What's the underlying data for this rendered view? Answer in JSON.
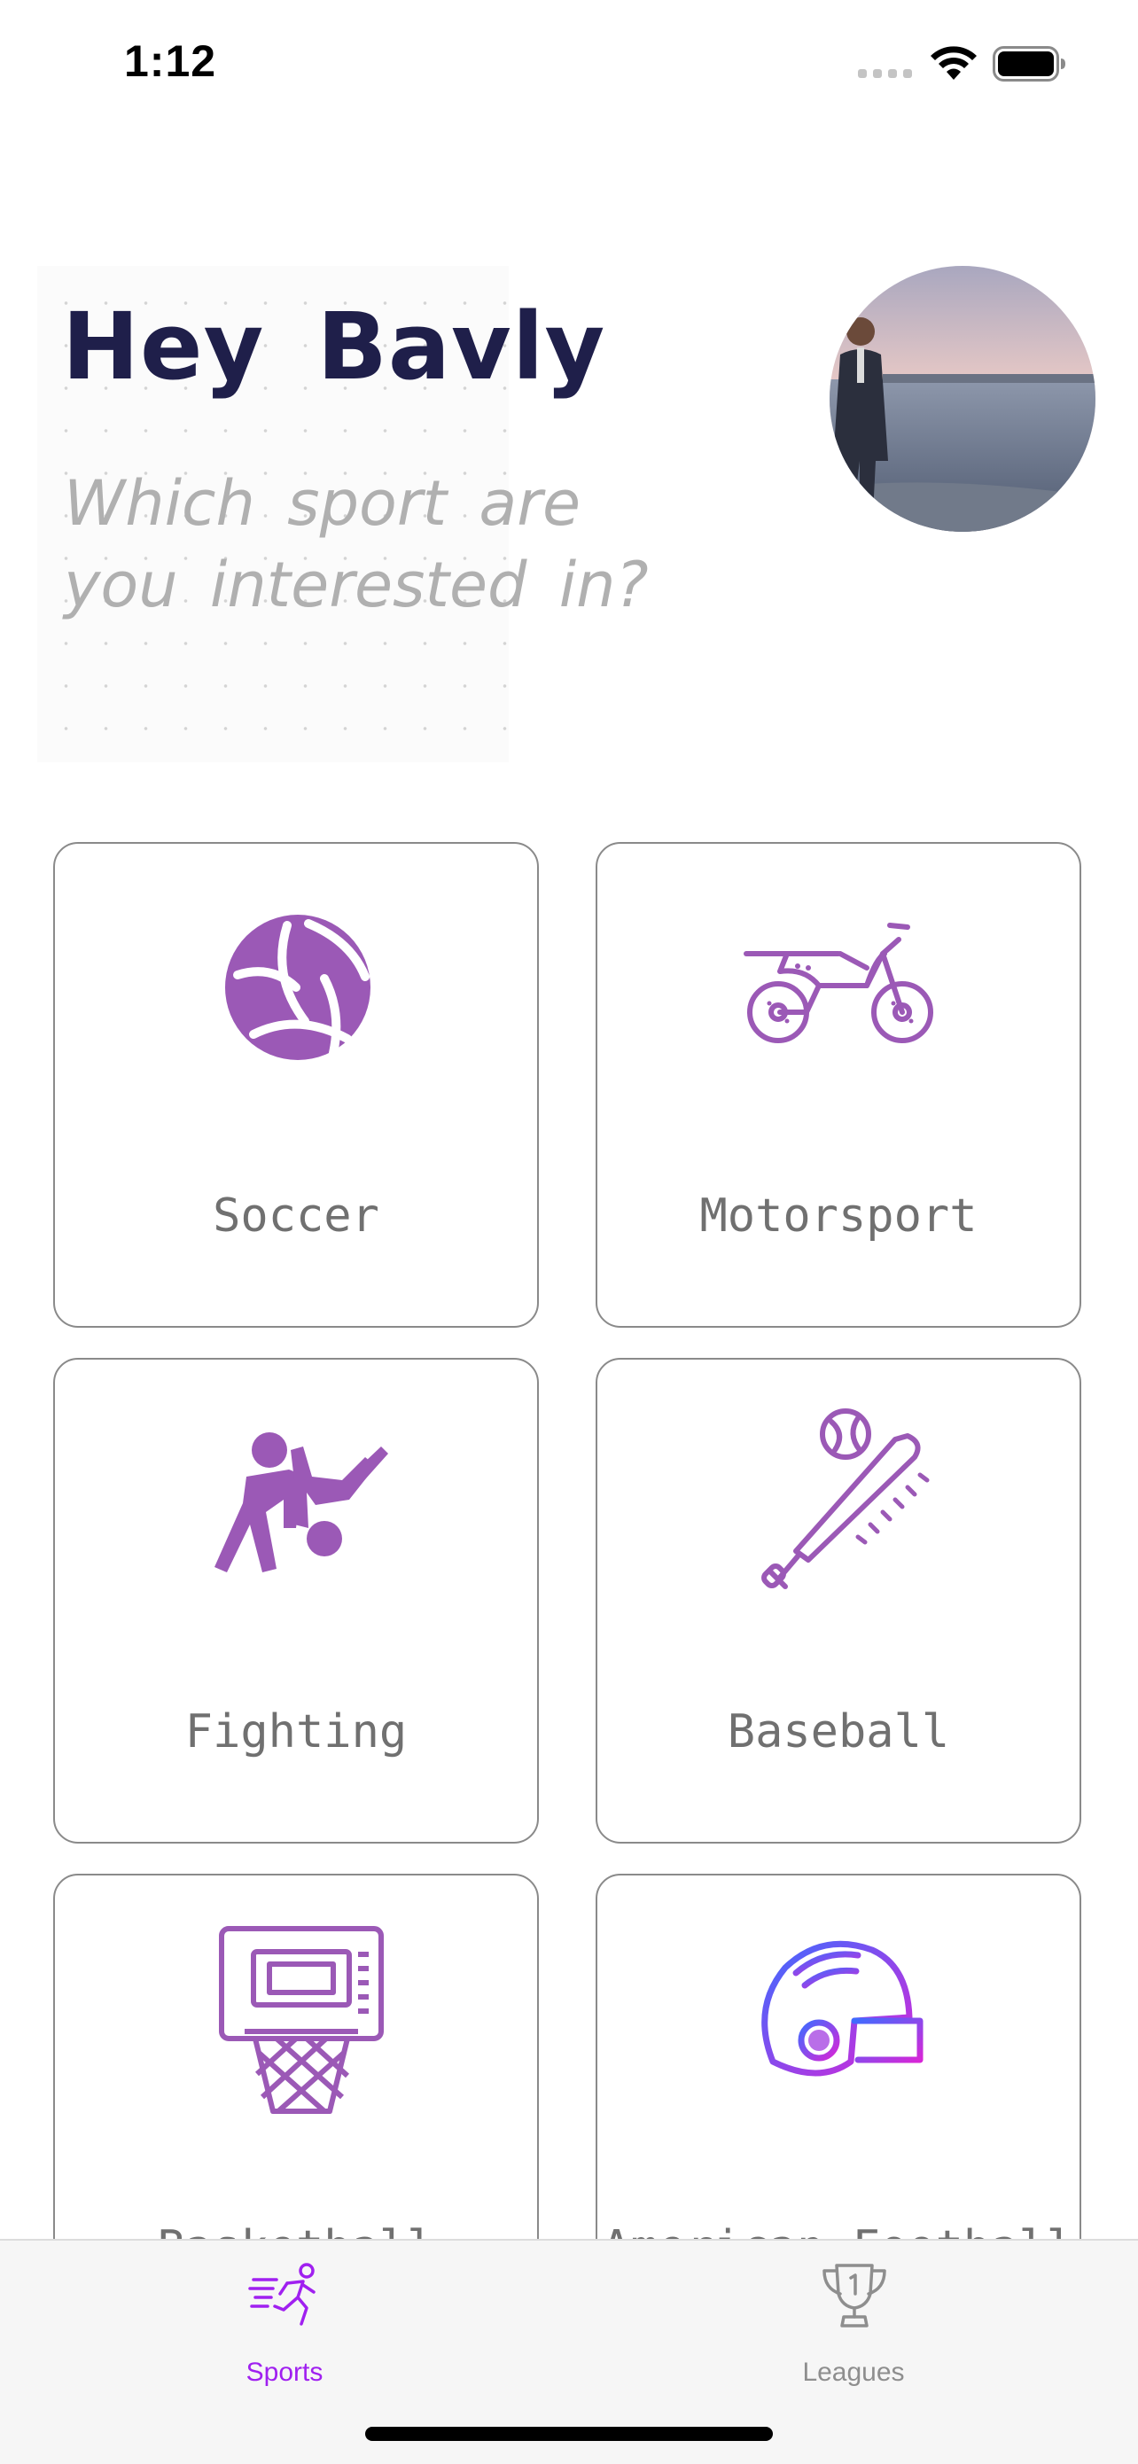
{
  "status_bar": {
    "time": "1:12",
    "icons": [
      "cellular-signal-icon",
      "wifi-icon",
      "battery-icon"
    ]
  },
  "header": {
    "greeting": "Hey Bavly",
    "subtitle": "Which sport are you interested in?",
    "avatar": "profile-photo"
  },
  "sports": [
    {
      "label": "Soccer",
      "icon": "volleyball-icon"
    },
    {
      "label": "Motorsport",
      "icon": "motorbike-icon"
    },
    {
      "label": "Fighting",
      "icon": "fighting-icon"
    },
    {
      "label": "Baseball",
      "icon": "baseball-bat-icon"
    },
    {
      "label": "Basketball",
      "icon": "basketball-hoop-icon"
    },
    {
      "label": "American Football",
      "icon": "football-helmet-icon"
    }
  ],
  "tab_bar": {
    "tabs": [
      {
        "label": "Sports",
        "icon": "running-person-icon",
        "selected": true
      },
      {
        "label": "Leagues",
        "icon": "trophy-icon",
        "selected": false
      }
    ]
  },
  "colors": {
    "accent": "#9b59b6",
    "tab_selected": "#a020f0",
    "tab_unselected": "#8e8e8e",
    "greeting": "#1f1f4a",
    "subtitle": "#b0b0b0",
    "card_border": "#8a8a8a"
  }
}
